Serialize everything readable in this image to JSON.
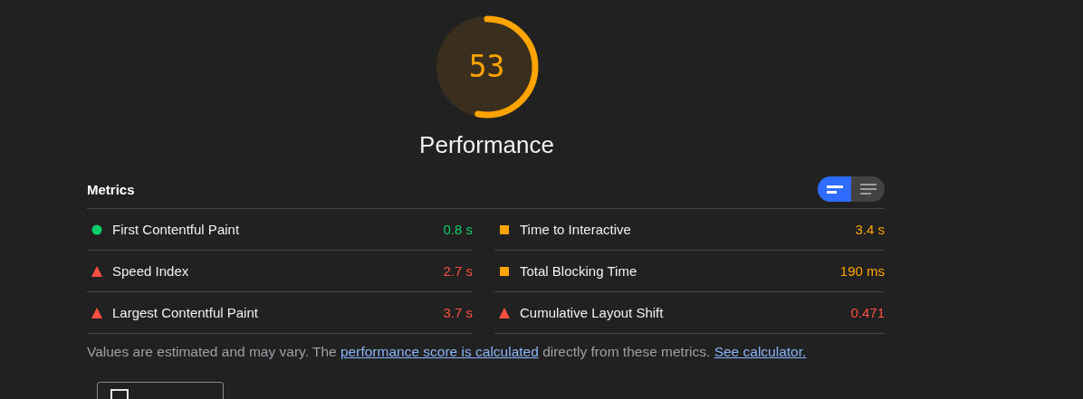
{
  "gauge": {
    "score": "53",
    "level": 0.53,
    "title": "Performance"
  },
  "metrics": {
    "title": "Metrics",
    "view_toggle": [
      {
        "kind": "summary",
        "selected": true
      },
      {
        "kind": "list",
        "selected": false
      }
    ],
    "items": [
      {
        "label": "First Contentful Paint",
        "value": "0.8 s",
        "kind": "pass"
      },
      {
        "label": "Time to Interactive",
        "value": "3.4 s",
        "kind": "average"
      },
      {
        "label": "Speed Index",
        "value": "2.7 s",
        "kind": "fail"
      },
      {
        "label": "Total Blocking Time",
        "value": "190 ms",
        "kind": "average"
      },
      {
        "label": "Largest Contentful Paint",
        "value": "3.7 s",
        "kind": "fail"
      },
      {
        "label": "Cumulative Layout Shift",
        "value": "0.471",
        "kind": "fail"
      }
    ]
  },
  "note": {
    "before": "Values are estimated and may vary. The ",
    "link1": "performance score is calculated",
    "middle": " directly from these metrics. ",
    "link2": "See calculator."
  },
  "bottom_button": {
    "kind": "treemap"
  }
}
